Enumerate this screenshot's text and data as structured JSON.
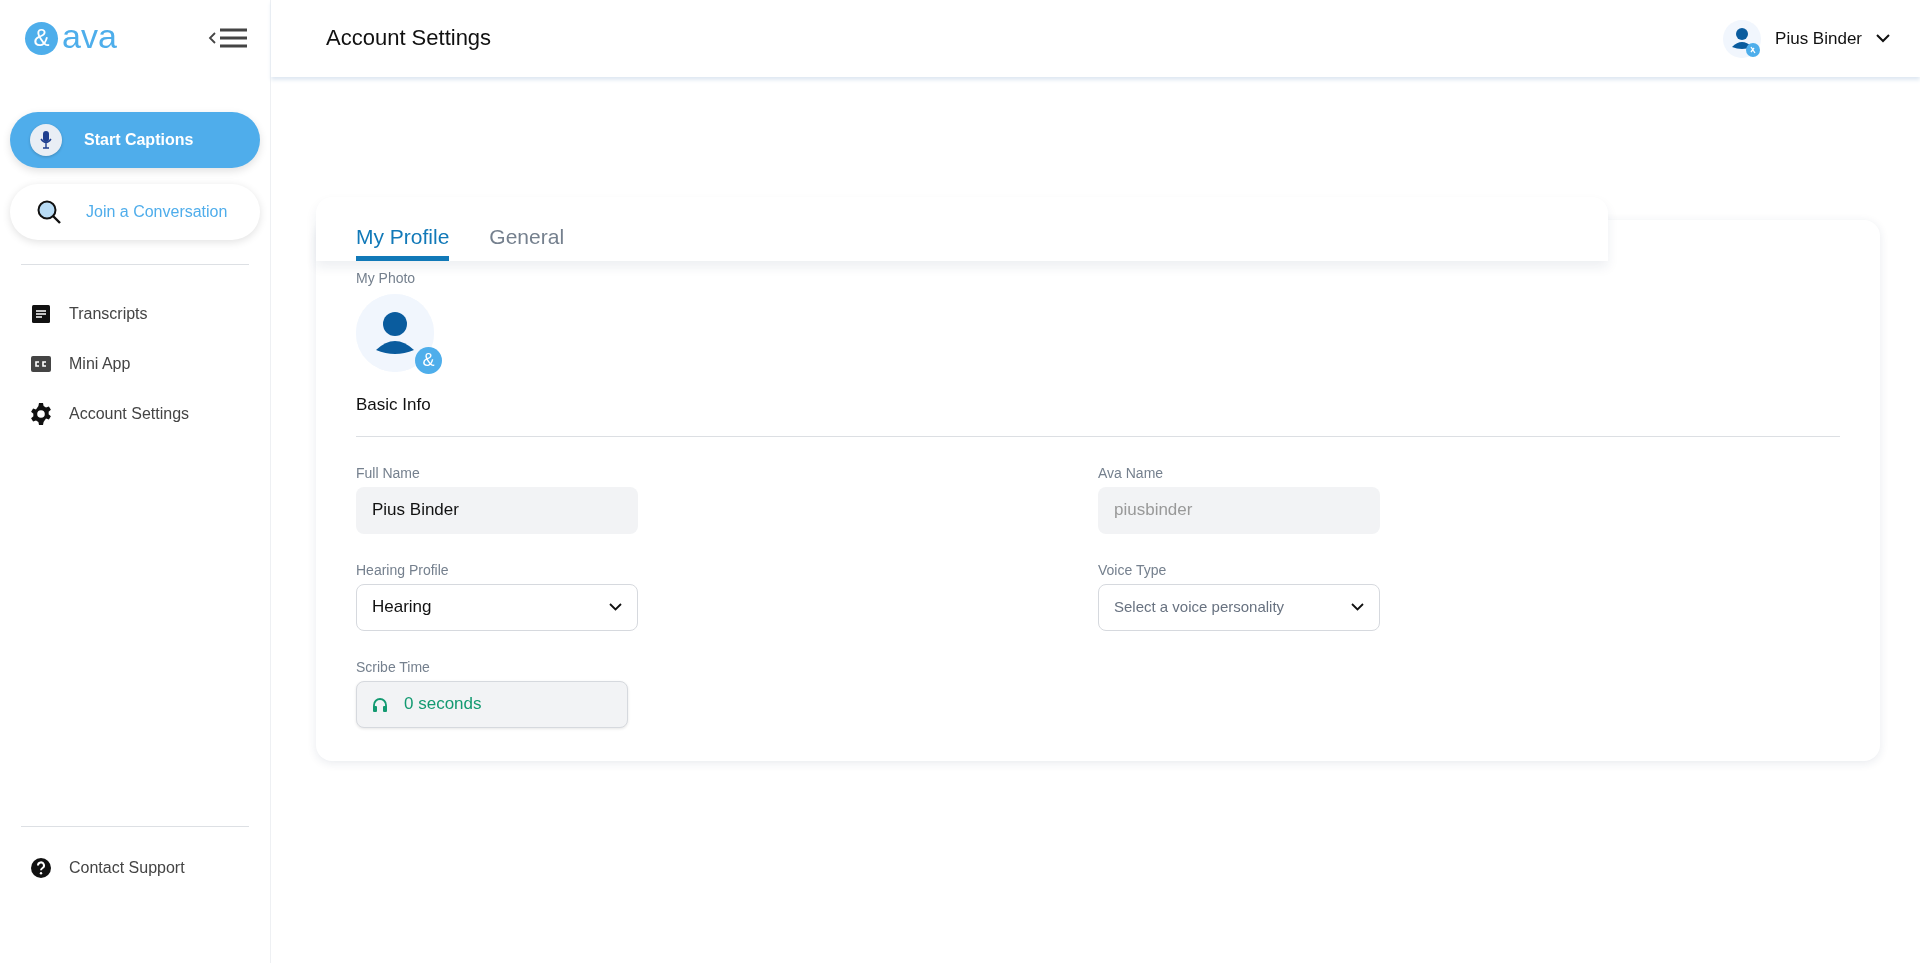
{
  "sidebar": {
    "logo": {
      "mark": "&",
      "text": "ava"
    },
    "actions": [
      {
        "kind": "primary",
        "label": "Start Captions"
      },
      {
        "kind": "secondary",
        "label": "Join a Conversation"
      }
    ],
    "nav": [
      {
        "label": "Transcripts"
      },
      {
        "label": "Mini App"
      },
      {
        "label": "Account Settings"
      }
    ],
    "footer": [
      {
        "label": "Contact Support"
      }
    ]
  },
  "header": {
    "title": "Account Settings",
    "user": {
      "name": "Pius Binder"
    }
  },
  "tabs": [
    {
      "label": "My Profile",
      "selected": true
    },
    {
      "label": "General",
      "selected": false
    }
  ],
  "profile": {
    "photo_label": "My Photo",
    "section_title": "Basic Info",
    "fields": [
      {
        "kind": "text",
        "label": "Full Name",
        "value": "Pius Binder",
        "disabled": false
      },
      {
        "kind": "text",
        "label": "Ava Name",
        "value": "piusbinder",
        "disabled": true
      },
      {
        "kind": "select",
        "label": "Hearing Profile",
        "value": "Hearing"
      },
      {
        "kind": "select",
        "label": "Voice Type",
        "placeholder": "Select a voice personality"
      },
      {
        "kind": "timer",
        "label": "Scribe Time",
        "value": "0 seconds"
      }
    ]
  }
}
